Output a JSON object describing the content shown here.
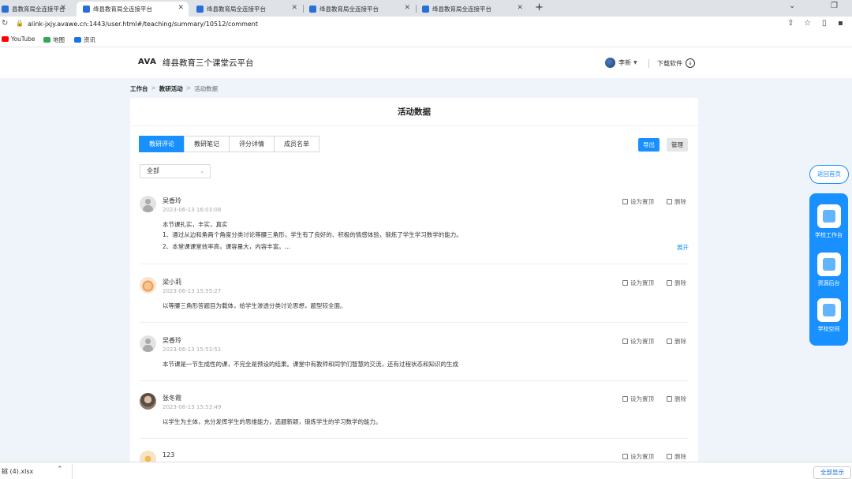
{
  "browser": {
    "tabs": [
      {
        "title": "县教育局全连接平台"
      },
      {
        "title": "绛县教育局全连接平台"
      },
      {
        "title": "绛县教育局全连接平台"
      },
      {
        "title": "绛县教育局全连接平台"
      },
      {
        "title": "绛县教育局全连接平台"
      }
    ],
    "url": "alink-jxjy.avawe.cn:1443/user.html#/teaching/summary/10512/comment",
    "bookmarks": [
      {
        "label": "YouTube",
        "color": "#ff0000"
      },
      {
        "label": "地图",
        "color": "#34a853"
      },
      {
        "label": "资讯",
        "color": "#1a73e8"
      }
    ]
  },
  "site": {
    "logo": "AVA",
    "name": "绛县教育三个课堂云平台",
    "user": "李新",
    "download": "下载软件"
  },
  "breadcrumb": {
    "items": [
      "工作台",
      "教研活动",
      "活动数据"
    ]
  },
  "card": {
    "title": "活动数据",
    "tabs": [
      "教研评论",
      "教研笔记",
      "评分详情",
      "成员名单"
    ],
    "active_tab": "教研评论",
    "export": "导出",
    "manage": "管理",
    "filter": "全部",
    "set_top": "设为置顶",
    "delete": "删除",
    "expand": "展开"
  },
  "comments": [
    {
      "name": "吴香玲",
      "time": "2023-06-13 16:03:08",
      "lines": [
        "本节课扎实，丰实，真实",
        "1、通过从边和角两个角度分类讨论等腰三角形，学生有了良好的、积极的情感体验，锻炼了学生学习数学的能力。",
        "2、本堂课课堂效率高，课容量大，内容丰富。..."
      ]
    },
    {
      "name": "梁小莉",
      "time": "2023-06-13 15:55:27",
      "lines": [
        "以等腰三角形答题目为载体，给学生渗透分类讨论思想，题型较全面。"
      ]
    },
    {
      "name": "吴香玲",
      "time": "2023-06-13 15:53:51",
      "lines": [
        "本节课是一节生成性的课，不完全是预设的结果。课堂中有教师和同学们智慧的交流，还有过程状态和知识的生成"
      ]
    },
    {
      "name": "张冬霞",
      "time": "2023-06-13 15:53:49",
      "lines": [
        "以学生为主体，充分发挥学生的思维能力，选题新颖，锻炼学生的学习数学的能力。"
      ]
    },
    {
      "name": "123",
      "time": "",
      "lines": []
    }
  ],
  "side": {
    "back_home": "返回首页",
    "items": [
      "学校工作台",
      "资源后台",
      "学校空间"
    ]
  },
  "downloads": {
    "file": "鐩 (4).xlsx",
    "show_all": "全部显示"
  }
}
